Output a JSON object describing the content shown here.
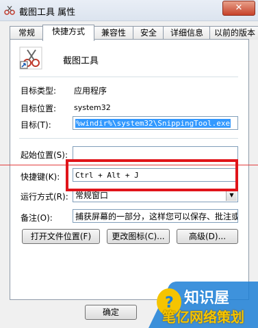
{
  "window": {
    "title": "截图工具 属性",
    "close_label": "✕"
  },
  "tabs": [
    {
      "label": "常规"
    },
    {
      "label": "快捷方式"
    },
    {
      "label": "兼容性"
    },
    {
      "label": "安全"
    },
    {
      "label": "详细信息"
    },
    {
      "label": "以前的版本"
    }
  ],
  "file_name": "截图工具",
  "fields": {
    "target_type_label": "目标类型:",
    "target_type_value": "应用程序",
    "target_location_label": "目标位置:",
    "target_location_value": "system32",
    "target_label": "目标(T):",
    "target_value": "%windir%\\system32\\SnippingTool.exe",
    "start_in_label": "起始位置(S):",
    "start_in_value": "",
    "shortcut_key_label": "快捷键(K):",
    "shortcut_key_value": "Ctrl + Alt + J",
    "run_label": "运行方式(R):",
    "run_value": "常规窗口",
    "comment_label": "备注(O):",
    "comment_value": "捕获屏幕的一部分，这样您可以保存、批注或"
  },
  "buttons": {
    "open_location": "打开文件位置(F)",
    "change_icon": "更改图标(C)...",
    "advanced": "高级(D)...",
    "ok": "确定"
  },
  "watermark": {
    "line1": "知识屋",
    "line2": "笔亿网络策划"
  },
  "colors": {
    "highlight_box": "#e0141a",
    "selection": "#3399ff",
    "watermark_blue": "#1c7fd6",
    "watermark_yellow": "#f5c400"
  }
}
